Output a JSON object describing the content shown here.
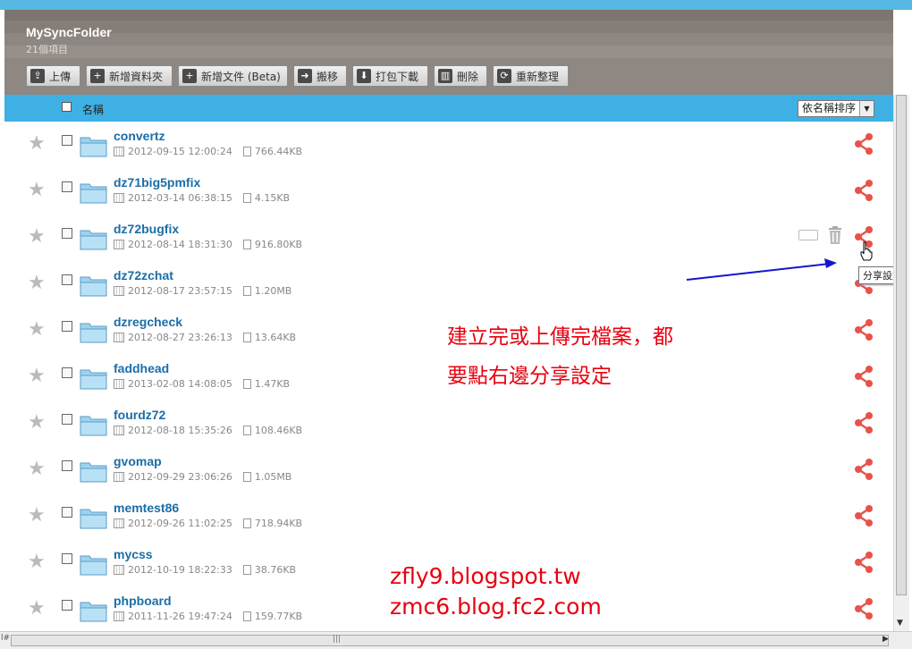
{
  "app": {
    "folder_title": "MySyncFolder",
    "item_count": "21個項目"
  },
  "toolbar": {
    "upload": "上傳",
    "new_folder": "新增資料夾",
    "new_doc": "新增文件 (Beta)",
    "move": "搬移",
    "download_zip": "打包下載",
    "delete": "刪除",
    "refresh": "重新整理"
  },
  "list_header": {
    "name_col": "名稱",
    "sort_label": "依名稱排序"
  },
  "files": [
    {
      "name": "convertz",
      "date": "2012-09-15 12:00:24",
      "size": "766.44KB"
    },
    {
      "name": "dz71big5pmfix",
      "date": "2012-03-14 06:38:15",
      "size": "4.15KB"
    },
    {
      "name": "dz72bugfix",
      "date": "2012-08-14 18:31:30",
      "size": "916.80KB"
    },
    {
      "name": "dz72zchat",
      "date": "2012-08-17 23:57:15",
      "size": "1.20MB"
    },
    {
      "name": "dzregcheck",
      "date": "2012-08-27 23:26:13",
      "size": "13.64KB"
    },
    {
      "name": "faddhead",
      "date": "2013-02-08 14:08:05",
      "size": "1.47KB"
    },
    {
      "name": "fourdz72",
      "date": "2012-08-18 15:35:26",
      "size": "108.46KB"
    },
    {
      "name": "gvomap",
      "date": "2012-09-29 23:06:26",
      "size": "1.05MB"
    },
    {
      "name": "memtest86",
      "date": "2012-09-26 11:02:25",
      "size": "718.94KB"
    },
    {
      "name": "mycss",
      "date": "2012-10-19 18:22:33",
      "size": "38.76KB"
    },
    {
      "name": "phpboard",
      "date": "2011-11-26 19:47:24",
      "size": "159.77KB"
    }
  ],
  "tooltip": "分享設定",
  "annotation": {
    "line1": "建立完或上傳完檔案，都",
    "line2": "要點右邊分享設定"
  },
  "watermark": {
    "line1": "zfly9.blogspot.tw",
    "line2": "zmc6.blog.fc2.com"
  },
  "statusbar": {
    "left_text": "l#"
  },
  "colors": {
    "share": "#e8524a",
    "link": "#1a6ea7",
    "header_blue": "#3fb0e4",
    "annotation": "#e8000e"
  },
  "icons": [
    "star-icon",
    "folder-icon",
    "calendar-icon",
    "document-icon",
    "share-icon",
    "trash-icon",
    "rename-icon",
    "hand-cursor-icon"
  ]
}
